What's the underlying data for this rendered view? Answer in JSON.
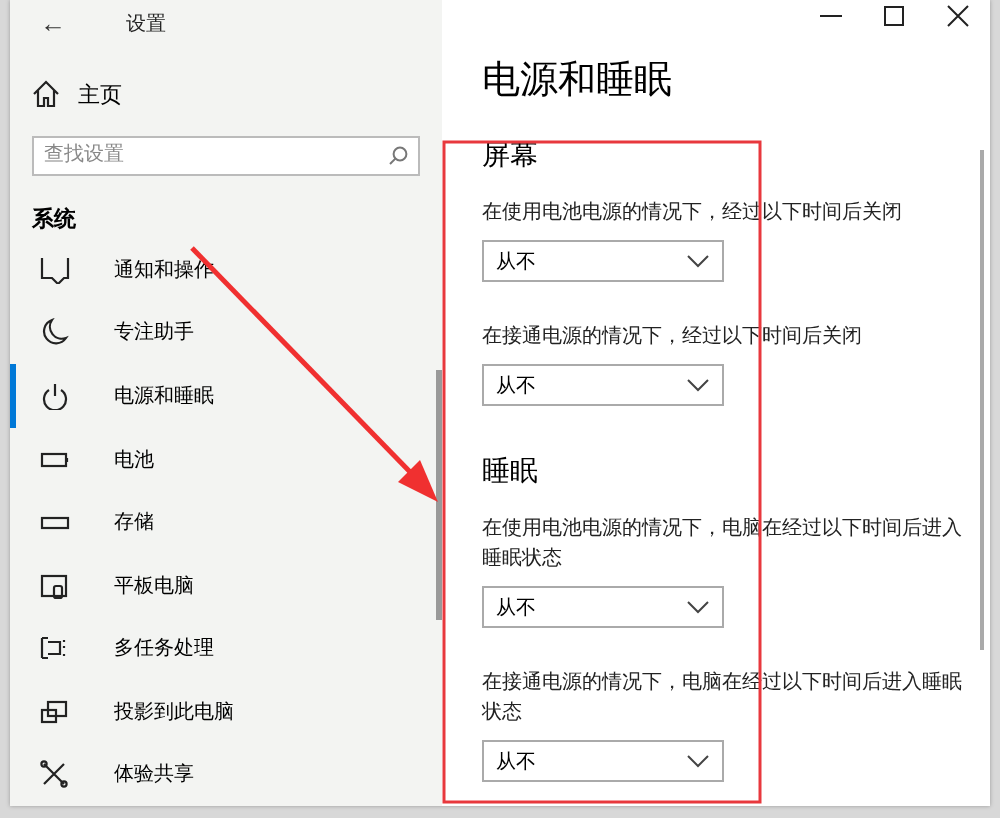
{
  "window": {
    "title": "设置",
    "back": "←",
    "controls": [
      {
        "kind": "minimize"
      },
      {
        "kind": "maximize"
      },
      {
        "kind": "close"
      }
    ]
  },
  "sidebar": {
    "home": "主页",
    "search": {
      "placeholder": "查找设置"
    },
    "section": "系统",
    "items": [
      {
        "label": "通知和操作",
        "selected": false
      },
      {
        "label": "专注助手",
        "selected": false
      },
      {
        "label": "电源和睡眠",
        "selected": true
      },
      {
        "label": "电池",
        "selected": false
      },
      {
        "label": "存储",
        "selected": false
      },
      {
        "label": "平板电脑",
        "selected": false
      },
      {
        "label": "多任务处理",
        "selected": false
      },
      {
        "label": "投影到此电脑",
        "selected": false
      },
      {
        "label": "体验共享",
        "selected": false
      }
    ]
  },
  "content": {
    "heading": "电源和睡眠",
    "sections": [
      {
        "title": "屏幕",
        "settings": [
          {
            "label": "在使用电池电源的情况下，经过以下时间后关闭",
            "value": "从不"
          },
          {
            "label": "在接通电源的情况下，经过以下时间后关闭",
            "value": "从不"
          }
        ]
      },
      {
        "title": "睡眠",
        "settings": [
          {
            "label": "在使用电池电源的情况下，电脑在经过以下时间后进入睡眠状态",
            "value": "从不"
          },
          {
            "label": "在接通电源的情况下，电脑在经过以下时间后进入睡眠状态",
            "value": "从不"
          }
        ]
      }
    ]
  },
  "annotation_arrow": true,
  "highlight_box": true
}
